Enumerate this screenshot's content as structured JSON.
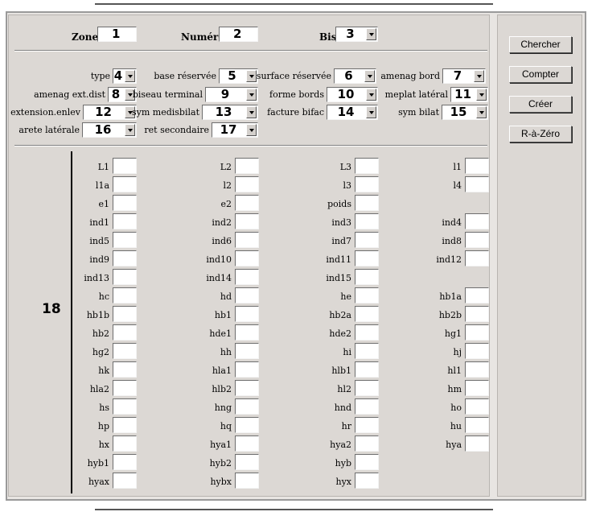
{
  "header_fields": {
    "zone": {
      "label": "Zone",
      "value": "1"
    },
    "numero": {
      "label": "Numéro",
      "value": "2"
    },
    "bis": {
      "label": "Bis",
      "value": "3"
    }
  },
  "selects": [
    {
      "label": "type",
      "value": "4"
    },
    {
      "label": "base réservée",
      "value": "5"
    },
    {
      "label": "surface réservée",
      "value": "6"
    },
    {
      "label": "amenag bord",
      "value": "7"
    },
    {
      "label": "amenag ext.dist",
      "value": "8"
    },
    {
      "label": "biseau terminal",
      "value": "9"
    },
    {
      "label": "forme bords",
      "value": "10"
    },
    {
      "label": "meplat latéral",
      "value": "11"
    },
    {
      "label": "extension.enlev",
      "value": "12"
    },
    {
      "label": "sym medisbilat",
      "value": "13"
    },
    {
      "label": "facture bifac",
      "value": "14"
    },
    {
      "label": "sym bilat",
      "value": "15"
    },
    {
      "label": "arete latérale",
      "value": "16"
    },
    {
      "label": "ret secondaire",
      "value": "17"
    }
  ],
  "measures_section": {
    "marker": "18"
  },
  "measures": [
    [
      "L1",
      "L2",
      "L3",
      "l1"
    ],
    [
      "l1a",
      "l2",
      "l3",
      "l4"
    ],
    [
      "e1",
      "e2",
      "poids",
      ""
    ],
    [
      "ind1",
      "ind2",
      "ind3",
      "ind4"
    ],
    [
      "ind5",
      "ind6",
      "ind7",
      "ind8"
    ],
    [
      "ind9",
      "ind10",
      "ind11",
      "ind12"
    ],
    [
      "ind13",
      "ind14",
      "ind15",
      ""
    ],
    [
      "hc",
      "hd",
      "he",
      "hb1a"
    ],
    [
      "hb1b",
      "hb1",
      "hb2a",
      "hb2b"
    ],
    [
      "hb2",
      "hde1",
      "hde2",
      "hg1"
    ],
    [
      "hg2",
      "hh",
      "hi",
      "hj"
    ],
    [
      "hk",
      "hla1",
      "hlb1",
      "hl1"
    ],
    [
      "hla2",
      "hlb2",
      "hl2",
      "hm"
    ],
    [
      "hs",
      "hng",
      "hnd",
      "ho"
    ],
    [
      "hp",
      "hq",
      "hr",
      "hu"
    ],
    [
      "hx",
      "hya1",
      "hya2",
      "hya"
    ],
    [
      "hyb1",
      "hyb2",
      "hyb",
      ""
    ],
    [
      "hyax",
      "hybx",
      "hyx",
      ""
    ]
  ],
  "buttons": {
    "search": "Chercher",
    "count": "Compter",
    "create": "Créer",
    "reset": "R-à-Zéro"
  }
}
